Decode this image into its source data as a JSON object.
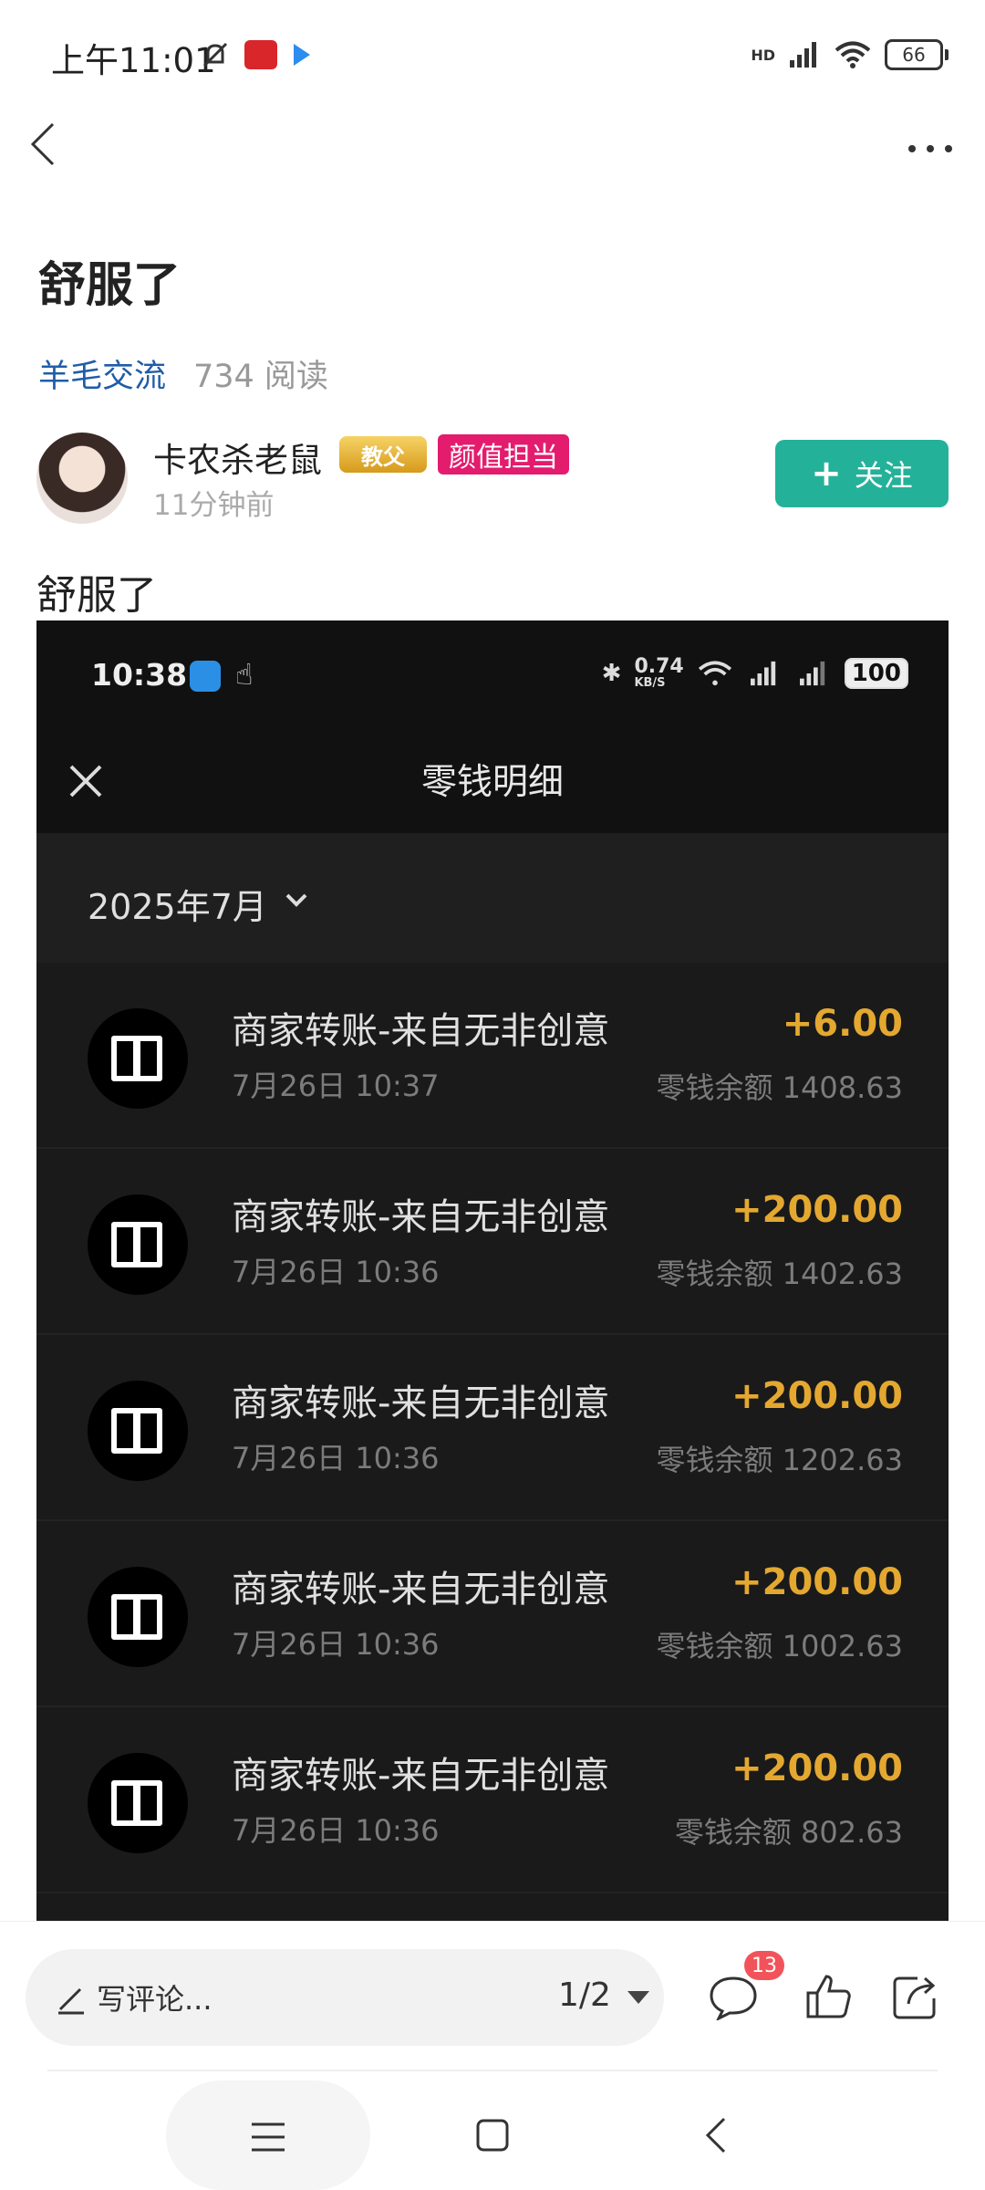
{
  "status_bar": {
    "time": "上午11:01",
    "battery": "66",
    "hd": "HD"
  },
  "post": {
    "title": "舒服了",
    "category": "羊毛交流",
    "reads": "734 阅读",
    "author": "卡农杀老鼠",
    "badge_gold": "教父",
    "badge_tag": "颜值担当",
    "time_ago": "11分钟前",
    "follow_label": "关注",
    "body": "舒服了"
  },
  "screenshot": {
    "time": "10:38",
    "net_speed": "0.74",
    "net_unit": "KB/S",
    "battery": "100",
    "title": "零钱明细",
    "month": "2025年7月",
    "transactions": [
      {
        "name": "商家转账-来自无非创意",
        "time": "7月26日 10:37",
        "amount": "+6.00",
        "balance": "零钱余额 1408.63"
      },
      {
        "name": "商家转账-来自无非创意",
        "time": "7月26日 10:36",
        "amount": "+200.00",
        "balance": "零钱余额 1402.63"
      },
      {
        "name": "商家转账-来自无非创意",
        "time": "7月26日 10:36",
        "amount": "+200.00",
        "balance": "零钱余额 1202.63"
      },
      {
        "name": "商家转账-来自无非创意",
        "time": "7月26日 10:36",
        "amount": "+200.00",
        "balance": "零钱余额 1002.63"
      },
      {
        "name": "商家转账-来自无非创意",
        "time": "7月26日 10:36",
        "amount": "+200.00",
        "balance": "零钱余额 802.63"
      }
    ]
  },
  "bottom_bar": {
    "comment_placeholder": "写评论...",
    "page_indicator": "1/2",
    "comment_count": "13"
  },
  "colors": {
    "accent": "#24b199",
    "link": "#1f5da8",
    "amount": "#e4a830",
    "badge": "#e31c6e"
  }
}
